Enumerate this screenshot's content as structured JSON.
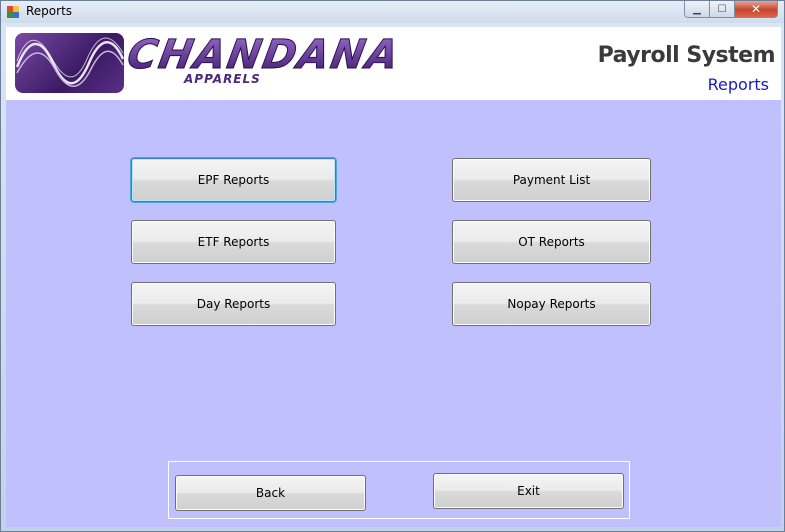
{
  "window": {
    "title": "Reports",
    "close_glyph": "✕",
    "minimize_glyph": "▁",
    "maximize_glyph": "☐"
  },
  "header": {
    "logo_text": "CHANDANA",
    "logo_sub": "APPARELS",
    "system_title": "Payroll System",
    "system_subtitle": "Reports"
  },
  "buttons": {
    "epf": "EPF Reports",
    "etf": "ETF Reports",
    "day": "Day Reports",
    "payment": "Payment List",
    "ot": "OT Reports",
    "nopay": "Nopay Reports"
  },
  "footer": {
    "back": "Back",
    "exit": "Exit"
  },
  "colors": {
    "client_bg": "#c0c0fe",
    "subtitle": "#1a1ab8",
    "logo_purple": "#5a2f86"
  }
}
